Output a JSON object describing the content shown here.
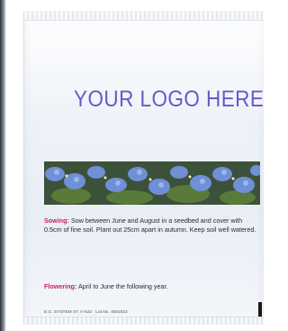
{
  "packet": {
    "logo_text": "YOUR LOGO HERE",
    "sowing": {
      "label": "Sowing:",
      "text": "Sow between June and August in a seedbed and cover with 0.5cm of fine soil. Plant out 25cm apart in autumn. Keep soil well watered."
    },
    "flowering": {
      "label": "Flowering:",
      "text": "April to June the following year."
    },
    "footer_text": "E.G. SYSTEM ST. H 622 · Lot.No. 4561822"
  },
  "colors": {
    "logo": "#6a58c4",
    "heading": "#c9215e"
  },
  "icons": [
    "flower-photo-strip",
    "barcode-icon"
  ]
}
